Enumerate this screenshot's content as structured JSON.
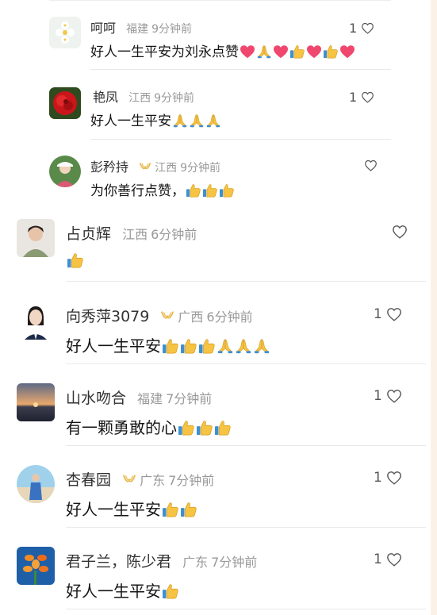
{
  "comments": [
    {
      "name": "呵呵",
      "badge": false,
      "region": "福建",
      "time": "9分钟前",
      "text": "好人一生平安为刘永点赞",
      "emojis": [
        "heart",
        "pray",
        "heart",
        "thumbs",
        "heart",
        "thumbs",
        "heart"
      ],
      "likes": "1"
    },
    {
      "name": "艳凤",
      "badge": false,
      "region": "江西",
      "time": "9分钟前",
      "text": "好人一生平安",
      "emojis": [
        "pray",
        "pray",
        "pray"
      ],
      "likes": "1"
    },
    {
      "name": "彭矜持",
      "badge": true,
      "region": "江西",
      "time": "9分钟前",
      "text": "为你善行点赞，",
      "emojis": [
        "thumbs",
        "thumbs",
        "thumbs"
      ],
      "likes": ""
    },
    {
      "name": "占贞辉",
      "badge": false,
      "region": "江西",
      "time": "6分钟前",
      "text": "",
      "emojis": [
        "thumbs"
      ],
      "likes": ""
    },
    {
      "name": "向秀萍3079",
      "badge": true,
      "region": "广西",
      "time": "6分钟前",
      "text": "好人一生平安",
      "emojis": [
        "thumbs",
        "thumbs",
        "thumbs",
        "pray",
        "pray",
        "pray"
      ],
      "likes": "1"
    },
    {
      "name": "山水吻合",
      "badge": false,
      "region": "福建",
      "time": "7分钟前",
      "text": "有一颗勇敢的心",
      "emojis": [
        "thumbs",
        "thumbs",
        "thumbs"
      ],
      "likes": "1"
    },
    {
      "name": "杏春园",
      "badge": true,
      "region": "广东",
      "time": "7分钟前",
      "text": "好人一生平安",
      "emojis": [
        "thumbs",
        "thumbs"
      ],
      "likes": "1"
    },
    {
      "name": "君子兰，陈少君",
      "badge": false,
      "region": "广东",
      "time": "7分钟前",
      "text": "好人一生平安",
      "emojis": [
        "thumbs"
      ],
      "likes": "1"
    }
  ],
  "icons": {
    "like": "heart-outline-icon",
    "badge": "gold-ribbon-badge-icon"
  },
  "colors": {
    "meta": "#999999",
    "text": "#161616",
    "badge": "#e8b84a",
    "heart_emoji": "#f0476e",
    "thumbs_emoji": "#f6c343"
  }
}
